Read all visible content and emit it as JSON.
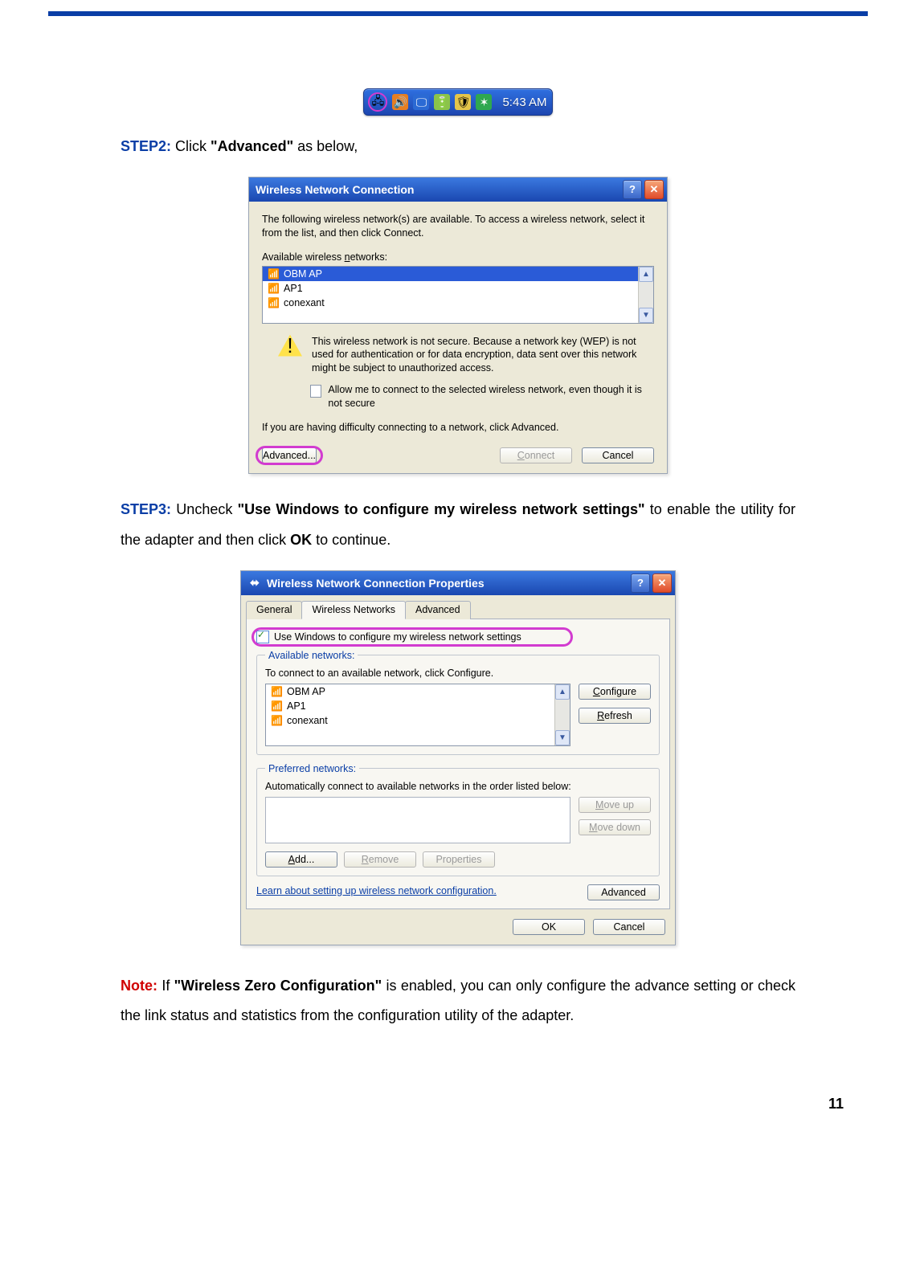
{
  "systray": {
    "icons": [
      "network-icon",
      "volume-icon",
      "display-icon",
      "battery-icon",
      "shield-icon",
      "antivirus-icon"
    ],
    "time": "5:43 AM"
  },
  "step2": {
    "label": "STEP2:",
    "pre": " Click ",
    "bold": "\"Advanced\"",
    "post": " as below,"
  },
  "dlg1": {
    "title": "Wireless Network Connection",
    "intro": "The following wireless network(s) are available. To access a wireless network, select it from the list, and then click Connect.",
    "list_label": "Available wireless networks:",
    "networks": [
      "OBM AP",
      "AP1",
      "conexant"
    ],
    "warn": "This wireless network is not secure. Because a network key (WEP) is not used for authentication or for data encryption, data sent over this network might be subject to unauthorized access.",
    "allow": "Allow me to connect to the selected wireless network, even though it is not secure",
    "difficulty": "If you are having difficulty connecting to a network, click Advanced.",
    "btn_adv": "Advanced...",
    "btn_connect": "Connect",
    "btn_cancel": "Cancel"
  },
  "step3": {
    "label": "STEP3:",
    "pre": " Uncheck ",
    "bold1": "\"Use Windows to configure my wireless network settings\"",
    "mid": " to enable the utility for the adapter and then click ",
    "bold2": "OK",
    "post": " to continue."
  },
  "dlg2": {
    "title": "Wireless Network Connection Properties",
    "tabs": [
      "General",
      "Wireless Networks",
      "Advanced"
    ],
    "active_tab": 1,
    "cb_label": "Use Windows to configure my wireless network settings",
    "grp_avail": "Available networks:",
    "avail_hint": "To connect to an available network, click Configure.",
    "networks": [
      "OBM AP",
      "AP1",
      "conexant"
    ],
    "btn_configure": "Configure",
    "btn_refresh": "Refresh",
    "grp_pref": "Preferred networks:",
    "pref_hint": "Automatically connect to available networks in the order listed below:",
    "btn_moveup": "Move up",
    "btn_movedown": "Move down",
    "btn_add": "Add...",
    "btn_remove": "Remove",
    "btn_props": "Properties",
    "learn": "Learn about setting up wireless network configuration.",
    "btn_advanced": "Advanced",
    "btn_ok": "OK",
    "btn_cancel": "Cancel"
  },
  "note": {
    "label": "Note:",
    "pre": " If ",
    "bold": "\"Wireless Zero Configuration\"",
    "post": " is enabled, you can only configure the advance setting or check the link status and statistics from the configuration utility of the adapter."
  },
  "page_number": "11"
}
